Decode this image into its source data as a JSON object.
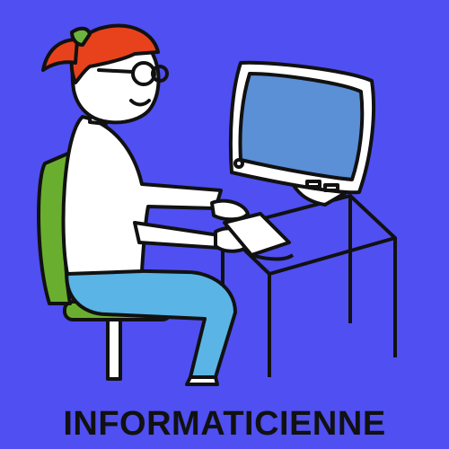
{
  "card": {
    "caption": "INFORMATICIENNE",
    "colors": {
      "background": "#4f4ff2",
      "caption_text": "#111111",
      "outline": "#111111",
      "hair": "#e8421c",
      "hair_tie": "#6db33f",
      "skin": "#ffffff",
      "shirt": "#ffffff",
      "pants": "#5ab4e5",
      "chair_seat": "#6aae2f",
      "chair_frame": "#ffffff",
      "monitor_body": "#ffffff",
      "monitor_screen": "#5b8fd6",
      "keyboard": "#ffffff",
      "desk_fill": "#4f4ff2"
    },
    "icons": {
      "illustration": "woman-typing-at-computer",
      "person": "woman-icon",
      "computer": "monitor-icon",
      "keyboard": "keyboard-icon",
      "chair": "chair-icon",
      "desk": "desk-icon"
    }
  }
}
